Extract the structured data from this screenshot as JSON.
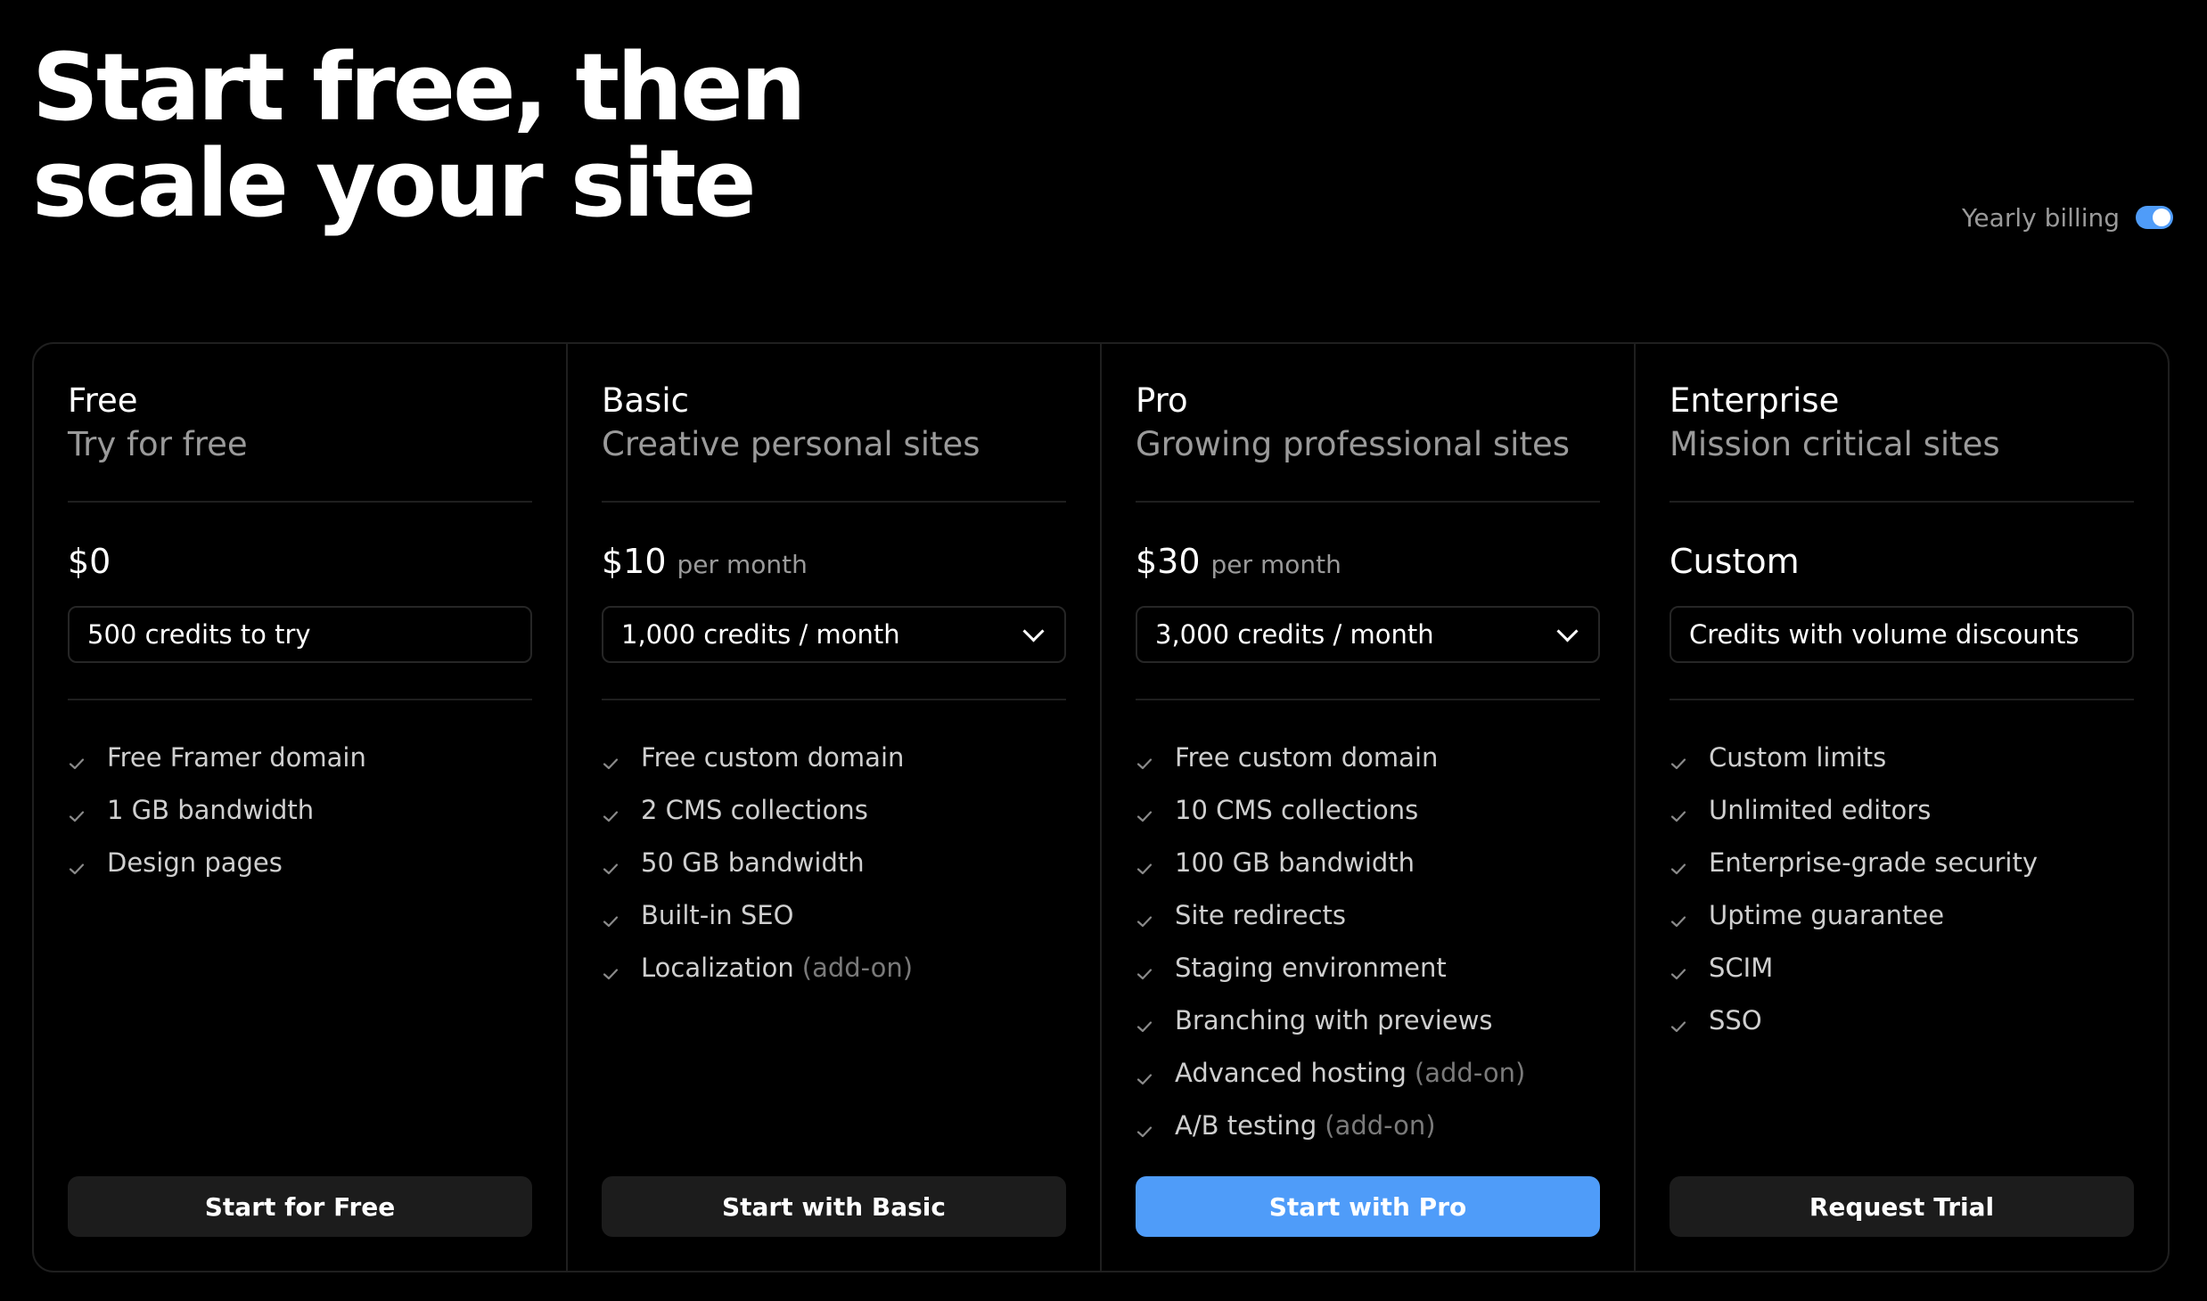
{
  "hero": {
    "title_line1": "Start free, then",
    "title_line2": "scale your site"
  },
  "billing": {
    "label": "Yearly billing",
    "enabled": true
  },
  "colors": {
    "accent": "#4f9cf9",
    "background": "#000000",
    "muted_text": "#9a9a9a",
    "button_dark": "#1c1c1c"
  },
  "plans": [
    {
      "name": "Free",
      "tagline": "Try for free",
      "price": "$0",
      "price_unit": "",
      "credits": "500 credits to try",
      "credits_dropdown": false,
      "features": [
        {
          "text": "Free Framer domain",
          "note": ""
        },
        {
          "text": "1 GB bandwidth",
          "note": ""
        },
        {
          "text": "Design pages",
          "note": ""
        }
      ],
      "button": "Start for Free",
      "button_primary": false
    },
    {
      "name": "Basic",
      "tagline": "Creative personal sites",
      "price": "$10",
      "price_unit": "per month",
      "credits": "1,000 credits / month",
      "credits_dropdown": true,
      "features": [
        {
          "text": "Free custom domain",
          "note": ""
        },
        {
          "text": "2 CMS collections",
          "note": ""
        },
        {
          "text": "50 GB bandwidth",
          "note": ""
        },
        {
          "text": "Built-in SEO",
          "note": ""
        },
        {
          "text": "Localization",
          "note": "(add-on)"
        }
      ],
      "button": "Start with Basic",
      "button_primary": false
    },
    {
      "name": "Pro",
      "tagline": "Growing professional sites",
      "price": "$30",
      "price_unit": "per month",
      "credits": "3,000 credits / month",
      "credits_dropdown": true,
      "features": [
        {
          "text": "Free custom domain",
          "note": ""
        },
        {
          "text": "10 CMS collections",
          "note": ""
        },
        {
          "text": "100 GB bandwidth",
          "note": ""
        },
        {
          "text": "Site redirects",
          "note": ""
        },
        {
          "text": "Staging environment",
          "note": ""
        },
        {
          "text": "Branching with previews",
          "note": ""
        },
        {
          "text": "Advanced hosting",
          "note": "(add-on)"
        },
        {
          "text": "A/B testing",
          "note": "(add-on)"
        }
      ],
      "button": "Start with Pro",
      "button_primary": true
    },
    {
      "name": "Enterprise",
      "tagline": "Mission critical sites",
      "price": "Custom",
      "price_unit": "",
      "credits": "Credits with volume discounts",
      "credits_dropdown": false,
      "features": [
        {
          "text": "Custom limits",
          "note": ""
        },
        {
          "text": "Unlimited editors",
          "note": ""
        },
        {
          "text": "Enterprise-grade security",
          "note": ""
        },
        {
          "text": "Uptime guarantee",
          "note": ""
        },
        {
          "text": "SCIM",
          "note": ""
        },
        {
          "text": "SSO",
          "note": ""
        }
      ],
      "button": "Request Trial",
      "button_primary": false
    }
  ]
}
